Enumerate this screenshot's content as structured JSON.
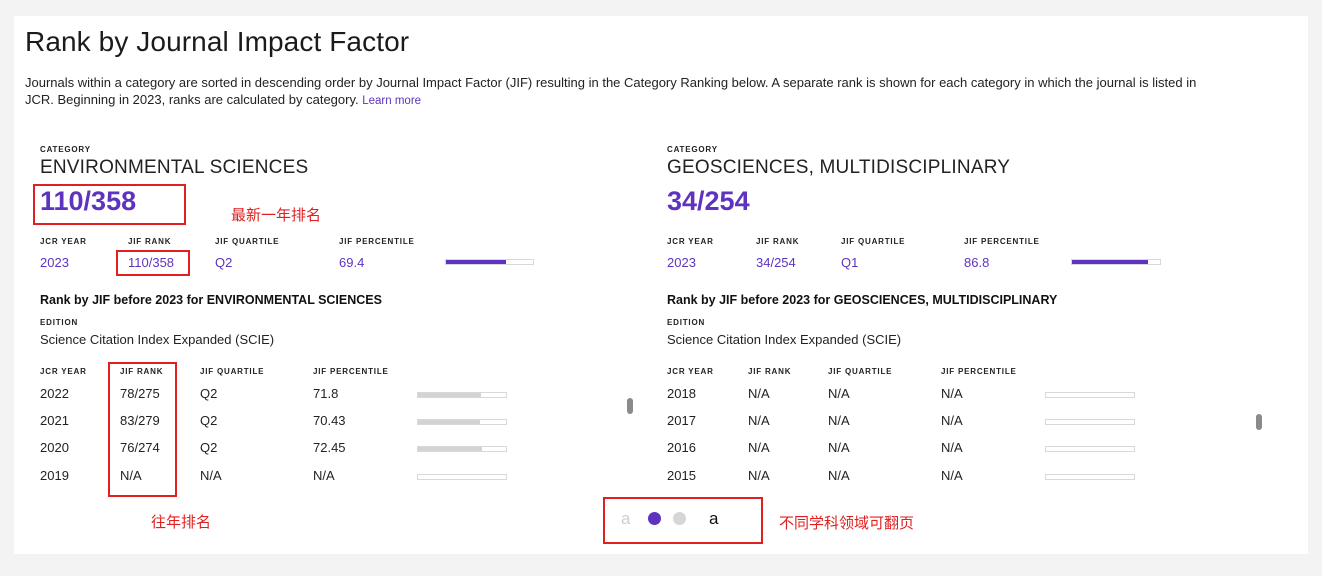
{
  "page": {
    "title": "Rank by Journal Impact Factor",
    "description": "Journals within a category are sorted in descending order by Journal Impact Factor (JIF) resulting in the Category Ranking below. A separate rank is shown for each category in which the journal is listed in JCR. Beginning in 2023, ranks are calculated by category.",
    "learn_more": "Learn more"
  },
  "headers": {
    "category": "CATEGORY",
    "jcr_year": "JCR YEAR",
    "jif_rank": "JIF RANK",
    "jif_quartile": "JIF QUARTILE",
    "jif_percentile": "JIF PERCENTILE",
    "edition": "EDITION"
  },
  "categories": [
    {
      "name": "ENVIRONMENTAL SCIENCES",
      "rank": "110/358",
      "current": {
        "year": "2023",
        "rank": "110/358",
        "quartile": "Q2",
        "percentile": "69.4",
        "percentile_value": 69.4
      },
      "history_title": "Rank by JIF before 2023 for ENVIRONMENTAL SCIENCES",
      "edition": "Science Citation Index Expanded (SCIE)",
      "history": [
        {
          "year": "2022",
          "rank": "78/275",
          "quartile": "Q2",
          "percentile": "71.8",
          "percentile_value": 71.8
        },
        {
          "year": "2021",
          "rank": "83/279",
          "quartile": "Q2",
          "percentile": "70.43",
          "percentile_value": 70.43
        },
        {
          "year": "2020",
          "rank": "76/274",
          "quartile": "Q2",
          "percentile": "72.45",
          "percentile_value": 72.45
        },
        {
          "year": "2019",
          "rank": "N/A",
          "quartile": "N/A",
          "percentile": "N/A",
          "percentile_value": 0
        }
      ]
    },
    {
      "name": "GEOSCIENCES, MULTIDISCIPLINARY",
      "rank": "34/254",
      "current": {
        "year": "2023",
        "rank": "34/254",
        "quartile": "Q1",
        "percentile": "86.8",
        "percentile_value": 86.8
      },
      "history_title": "Rank by JIF before 2023 for GEOSCIENCES, MULTIDISCIPLINARY",
      "edition": "Science Citation Index Expanded (SCIE)",
      "history": [
        {
          "year": "2018",
          "rank": "N/A",
          "quartile": "N/A",
          "percentile": "N/A",
          "percentile_value": 0
        },
        {
          "year": "2017",
          "rank": "N/A",
          "quartile": "N/A",
          "percentile": "N/A",
          "percentile_value": 0
        },
        {
          "year": "2016",
          "rank": "N/A",
          "quartile": "N/A",
          "percentile": "N/A",
          "percentile_value": 0
        },
        {
          "year": "2015",
          "rank": "N/A",
          "quartile": "N/A",
          "percentile": "N/A",
          "percentile_value": 0
        }
      ]
    }
  ],
  "pager": {
    "prev": "a",
    "next": "a",
    "active_index": 0,
    "count": 2
  },
  "annotations": {
    "latest_rank": "最新一年排名",
    "past_rank": "往年排名",
    "paging": "不同学科领域可翻页"
  },
  "colors": {
    "accent": "#5e33bf",
    "annotation": "#e02020"
  }
}
